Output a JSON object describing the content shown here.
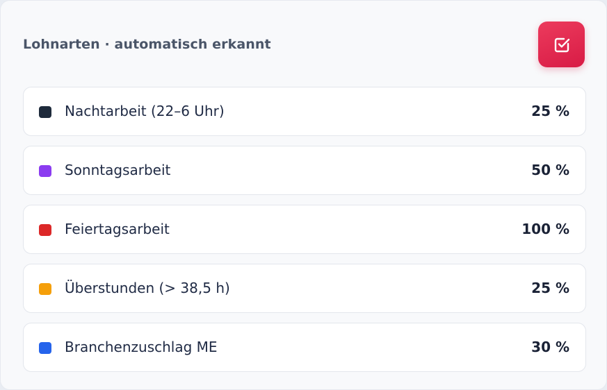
{
  "header": {
    "title": "Lohnarten · automatisch erkannt",
    "action_icon": "checkbox-check-icon",
    "accent": "#e0254c"
  },
  "rows": [
    {
      "label": "Nachtarbeit (22–6 Uhr)",
      "percent": "25 %",
      "color": "#1e2a3b"
    },
    {
      "label": "Sonntagsarbeit",
      "percent": "50 %",
      "color": "#8b3cf0"
    },
    {
      "label": "Feiertagsarbeit",
      "percent": "100 %",
      "color": "#dc2828"
    },
    {
      "label": "Überstunden (> 38,5 h)",
      "percent": "25 %",
      "color": "#f59f0a"
    },
    {
      "label": "Branchenzuschlag ME",
      "percent": "30 %",
      "color": "#2563eb"
    }
  ]
}
